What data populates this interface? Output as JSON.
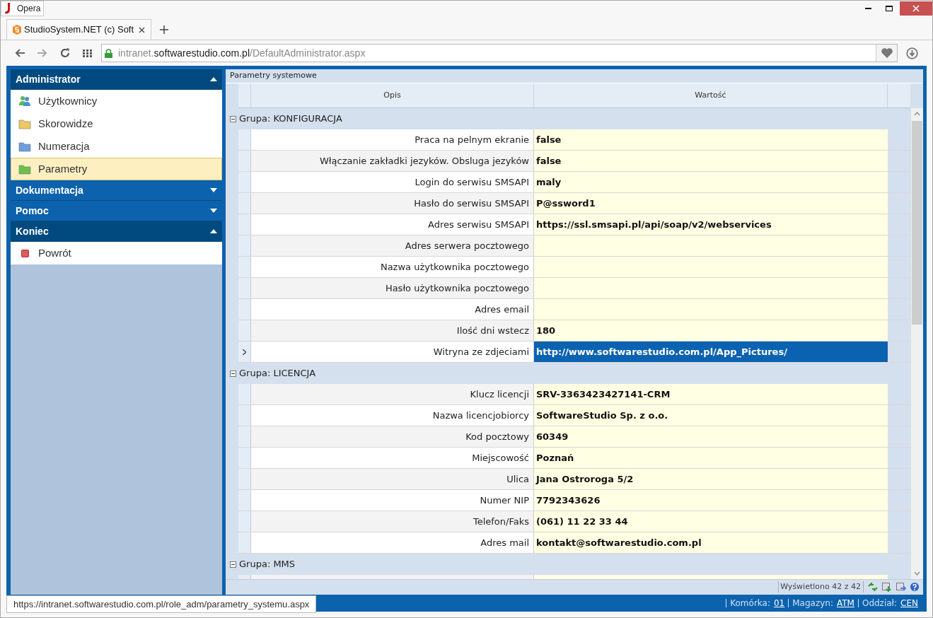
{
  "window": {
    "title": "Opera"
  },
  "tab": {
    "title": "StudioSystem.NET (c) Soft"
  },
  "address": {
    "host_prefix": "intranet.",
    "host": "softwarestudio.com.pl",
    "path": "/DefaultAdministrator.aspx"
  },
  "sidebar": [
    {
      "title": "Administrator",
      "expanded": true,
      "items": [
        {
          "label": "Użytkownicy",
          "kind": "users",
          "color": "#4a8fd8",
          "selected": false
        },
        {
          "label": "Skorowidze",
          "kind": "folder",
          "color": "#f0c860",
          "selected": false
        },
        {
          "label": "Numeracja",
          "kind": "folder",
          "color": "#6a9ee0",
          "selected": false
        },
        {
          "label": "Parametry",
          "kind": "folder",
          "color": "#6cc04a",
          "selected": true
        }
      ]
    },
    {
      "title": "Dokumentacja",
      "expanded": false
    },
    {
      "title": "Pomoc",
      "expanded": false
    },
    {
      "title": "Koniec",
      "expanded": true,
      "items": [
        {
          "label": "Powrót",
          "kind": "square",
          "color": "#e05a5a",
          "selected": false
        }
      ]
    }
  ],
  "grid": {
    "title": "Parametry systemowe",
    "columns": [
      "Opis",
      "Wartość"
    ],
    "groups": [
      {
        "label": "Grupa: KONFIGURACJA",
        "expanded": true,
        "rows": [
          {
            "opis": "Praca na pelnym ekranie",
            "wartosc": "false",
            "selected": false
          },
          {
            "opis": "Włączanie zakładki jezyków. Obsluga jezyków",
            "wartosc": "false",
            "selected": false
          },
          {
            "opis": "Login do serwisu SMSAPI",
            "wartosc": "maly",
            "selected": false
          },
          {
            "opis": "Hasło do serwisu SMSAPI",
            "wartosc": "P@ssword1",
            "selected": false
          },
          {
            "opis": "Adres serwisu SMSAPI",
            "wartosc": "https://ssl.smsapi.pl/api/soap/v2/webservices",
            "selected": false
          },
          {
            "opis": "Adres serwera pocztowego",
            "selected": false
          },
          {
            "opis": "Nazwa użytkownika pocztowego",
            "selected": false
          },
          {
            "opis": "Hasło użytkownika pocztowego",
            "selected": false
          },
          {
            "opis": "Adres email",
            "selected": false
          },
          {
            "opis": "Ilość dni wstecz",
            "wartosc": "180",
            "selected": false
          },
          {
            "opis": "Witryna ze zdjeciami",
            "wartosc": "http://www.softwarestudio.com.pl/App_Pictures/",
            "selected": true
          }
        ]
      },
      {
        "label": "Grupa: LICENCJA",
        "expanded": true,
        "rows": [
          {
            "opis": "Klucz licencji",
            "wartosc": "SRV-3363423427141-CRM",
            "selected": false
          },
          {
            "opis": "Nazwa licencjobiorcy",
            "wartosc": "SoftwareStudio Sp. z o.o.",
            "selected": false
          },
          {
            "opis": "Kod pocztowy",
            "wartosc": "60349",
            "selected": false
          },
          {
            "opis": "Miejscowość",
            "wartosc": "Poznań",
            "selected": false
          },
          {
            "opis": "Ulica",
            "wartosc": "Jana Ostroroga 5/2",
            "selected": false
          },
          {
            "opis": "Numer NIP",
            "wartosc": "7792343626",
            "selected": false
          },
          {
            "opis": "Telefon/Faks",
            "wartosc": "(061) 11 22 33 44",
            "selected": false
          },
          {
            "opis": "Adres mail",
            "wartosc": "kontakt@softwarestudio.com.pl",
            "selected": false
          }
        ]
      },
      {
        "label": "Grupa: MMS",
        "expanded": true,
        "rows": [
          {
            "selected": false
          }
        ]
      }
    ],
    "footer": "Wyświetlono 42 z 42"
  },
  "status_bar": [
    {
      "label": "Komórka:",
      "value": "01"
    },
    {
      "label": "Magazyn:",
      "value": "ATM"
    },
    {
      "label": "Oddział:",
      "value": "CEN"
    }
  ],
  "link_preview": "https://intranet.softwarestudio.com.pl/role_adm/parametry_systemu.aspx"
}
